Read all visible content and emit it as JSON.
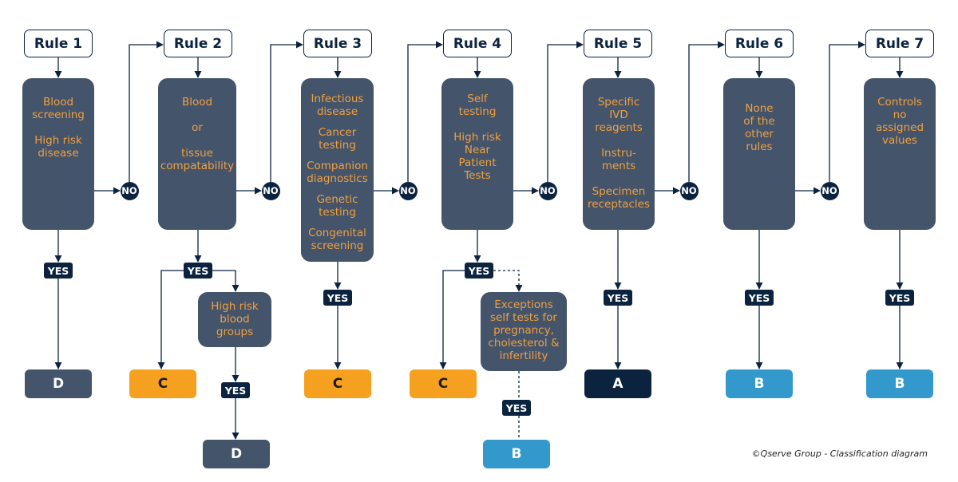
{
  "colors": {
    "navy": "#0c2340",
    "slate": "#44546a",
    "orange": "#f5a01f",
    "blue": "#3399cc",
    "criteria_text": "#f0a040"
  },
  "rules": [
    {
      "label": "Rule 1",
      "criteria": [
        [
          "Blood",
          "screening"
        ],
        [
          "High risk",
          "disease"
        ]
      ],
      "yes": "YES",
      "no": "NO",
      "result": "D",
      "result_color": "slate"
    },
    {
      "label": "Rule 2",
      "criteria": [
        [
          "Blood"
        ],
        [
          "or"
        ],
        [
          "tissue",
          "compatability"
        ]
      ],
      "yes": "YES",
      "no": "NO",
      "result": "C",
      "result_color": "orange"
    },
    {
      "label": "Rule 3",
      "criteria": [
        [
          "Infectious",
          "disease"
        ],
        [
          "Cancer",
          "testing"
        ],
        [
          "Companion",
          "diagnostics"
        ],
        [
          "Genetic",
          "testing"
        ],
        [
          "Congenital",
          "screening"
        ]
      ],
      "yes": "YES",
      "no": "NO",
      "result": "C",
      "result_color": "orange"
    },
    {
      "label": "Rule 4",
      "criteria": [
        [
          "Self",
          "testing"
        ],
        [
          "High risk",
          "Near",
          "Patient",
          "Tests"
        ]
      ],
      "yes": "YES",
      "no": "NO",
      "result": "C",
      "result_color": "orange"
    },
    {
      "label": "Rule 5",
      "criteria": [
        [
          "Specific",
          "IVD",
          "reagents"
        ],
        [
          "Instru-",
          "ments"
        ],
        [
          "Specimen",
          "receptacles"
        ]
      ],
      "yes": "YES",
      "no": "NO",
      "result": "A",
      "result_color": "navy"
    },
    {
      "label": "Rule 6",
      "criteria": [
        [
          "None",
          "of the",
          "other",
          "rules"
        ]
      ],
      "yes": "YES",
      "no": "NO",
      "result": "B",
      "result_color": "blue"
    },
    {
      "label": "Rule 7",
      "criteria": [
        [
          "Controls",
          "no",
          "assigned",
          "values"
        ]
      ],
      "yes": "YES",
      "result": "B",
      "result_color": "blue"
    }
  ],
  "rule2_sub": {
    "criteria": [
      [
        "High risk",
        "blood",
        "groups"
      ]
    ],
    "yes": "YES",
    "result": "D",
    "result_color": "slate"
  },
  "rule4_sub": {
    "criteria": [
      [
        "Exceptions",
        "self tests for",
        "pregnancy,",
        "cholesterol &",
        "infertility"
      ]
    ],
    "yes": "YES",
    "result": "B",
    "result_color": "blue"
  },
  "footer": {
    "copyright": "©Qserve Group - Classification diagram"
  }
}
